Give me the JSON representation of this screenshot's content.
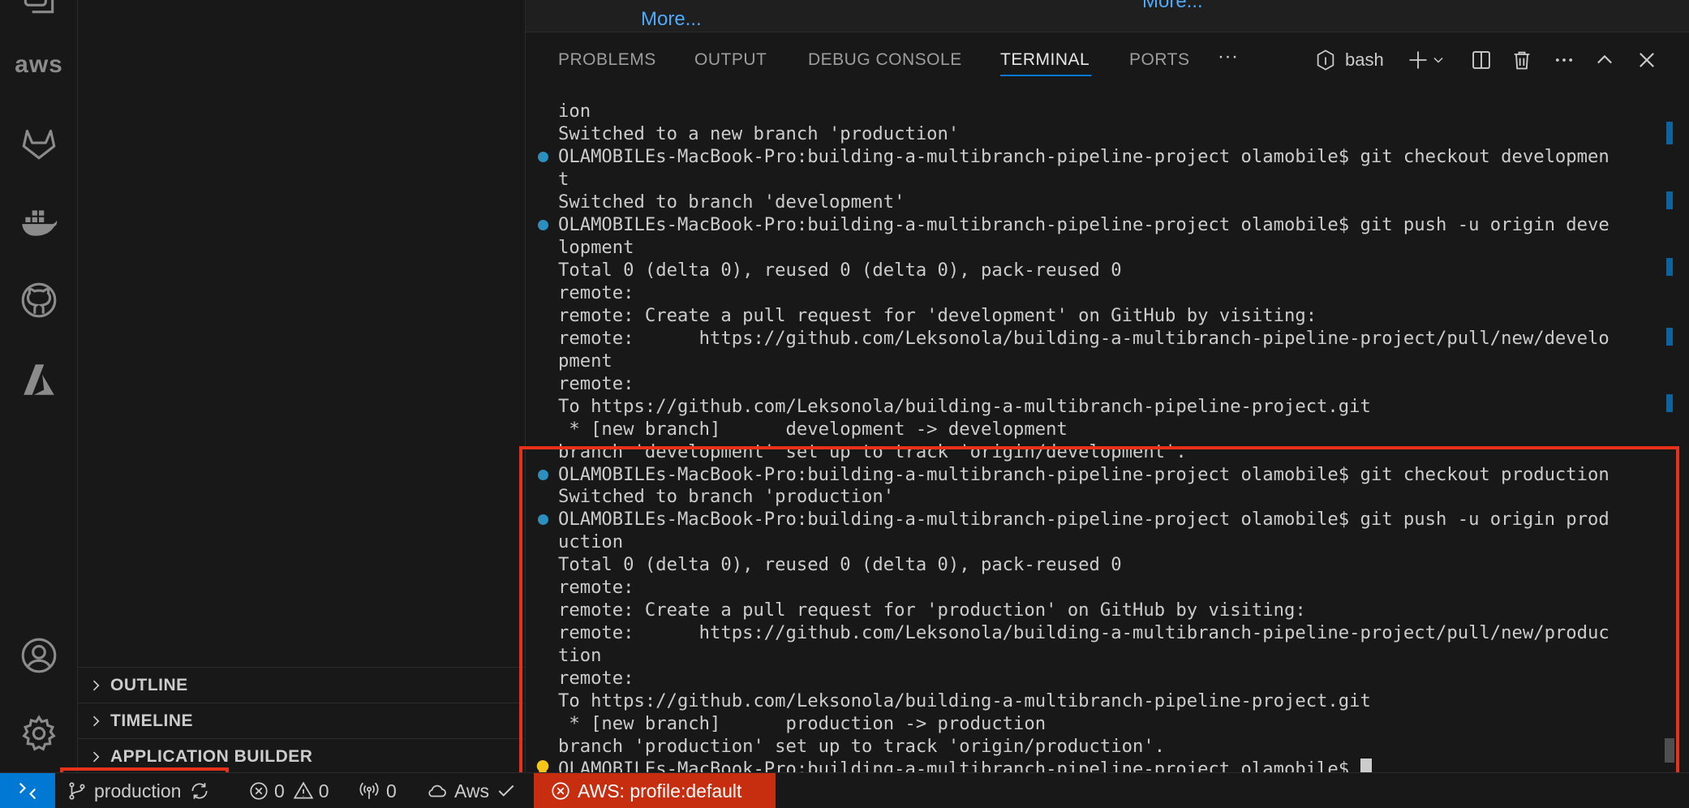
{
  "activity_bar": {
    "icons": [
      "accounts-icon",
      "aws-icon",
      "gitlab-icon",
      "docker-icon",
      "github-icon",
      "azure-icon",
      "account-icon",
      "settings-icon"
    ],
    "aws_text": "aws"
  },
  "side_bar": {
    "sections": [
      {
        "label": "OUTLINE"
      },
      {
        "label": "TIMELINE"
      },
      {
        "label": "APPLICATION BUILDER"
      }
    ]
  },
  "editor": {
    "more_link_1": "More...",
    "more_link_2": "More..."
  },
  "panel": {
    "tabs": [
      {
        "label": "PROBLEMS"
      },
      {
        "label": "OUTPUT"
      },
      {
        "label": "DEBUG CONSOLE"
      },
      {
        "label": "TERMINAL",
        "active": true
      },
      {
        "label": "PORTS"
      }
    ],
    "overflow": "···",
    "terminal_profile": "bash",
    "actions": [
      "new-terminal-icon",
      "split-terminal-icon",
      "kill-terminal-icon",
      "more-actions-icon",
      "maximize-panel-icon",
      "close-panel-icon"
    ]
  },
  "terminal": {
    "lines": [
      {
        "text": "ion",
        "marker": ""
      },
      {
        "text": "Switched to a new branch 'production'",
        "marker": ""
      },
      {
        "text": "OLAMOBILEs-MacBook-Pro:building-a-multibranch-pipeline-project olamobile$ git checkout developmen",
        "marker": "dot"
      },
      {
        "text": "t",
        "marker": ""
      },
      {
        "text": "Switched to branch 'development'",
        "marker": ""
      },
      {
        "text": "OLAMOBILEs-MacBook-Pro:building-a-multibranch-pipeline-project olamobile$ git push -u origin deve",
        "marker": "dot"
      },
      {
        "text": "lopment",
        "marker": ""
      },
      {
        "text": "Total 0 (delta 0), reused 0 (delta 0), pack-reused 0",
        "marker": ""
      },
      {
        "text": "remote:",
        "marker": ""
      },
      {
        "text": "remote: Create a pull request for 'development' on GitHub by visiting:",
        "marker": ""
      },
      {
        "text": "remote:      https://github.com/Leksonola/building-a-multibranch-pipeline-project/pull/new/develo",
        "marker": ""
      },
      {
        "text": "pment",
        "marker": ""
      },
      {
        "text": "remote:",
        "marker": ""
      },
      {
        "text": "To https://github.com/Leksonola/building-a-multibranch-pipeline-project.git",
        "marker": ""
      },
      {
        "text": " * [new branch]      development -> development",
        "marker": ""
      },
      {
        "text": "branch 'development' set up to track 'origin/development'.",
        "marker": ""
      },
      {
        "text": "OLAMOBILEs-MacBook-Pro:building-a-multibranch-pipeline-project olamobile$ git checkout production",
        "marker": "dot"
      },
      {
        "text": "Switched to branch 'production'",
        "marker": ""
      },
      {
        "text": "OLAMOBILEs-MacBook-Pro:building-a-multibranch-pipeline-project olamobile$ git push -u origin prod",
        "marker": "dot"
      },
      {
        "text": "uction",
        "marker": ""
      },
      {
        "text": "Total 0 (delta 0), reused 0 (delta 0), pack-reused 0",
        "marker": ""
      },
      {
        "text": "remote:",
        "marker": ""
      },
      {
        "text": "remote: Create a pull request for 'production' on GitHub by visiting:",
        "marker": ""
      },
      {
        "text": "remote:      https://github.com/Leksonola/building-a-multibranch-pipeline-project/pull/new/produc",
        "marker": ""
      },
      {
        "text": "tion",
        "marker": ""
      },
      {
        "text": "remote:",
        "marker": ""
      },
      {
        "text": "To https://github.com/Leksonola/building-a-multibranch-pipeline-project.git",
        "marker": ""
      },
      {
        "text": " * [new branch]      production -> production",
        "marker": ""
      },
      {
        "text": "branch 'production' set up to track 'origin/production'.",
        "marker": ""
      },
      {
        "text": "OLAMOBILEs-MacBook-Pro:building-a-multibranch-pipeline-project olamobile$ ",
        "marker": "bulb"
      }
    ]
  },
  "status_bar": {
    "branch": "production",
    "errors": "0",
    "warnings": "0",
    "ports": "0",
    "aws_connection": "Aws",
    "aws_profile": "AWS: profile:default"
  },
  "colors": {
    "accent": "#0078d4",
    "highlight_box": "#e8311a",
    "aws_profile_bg": "#c72e0f",
    "decoration_dot": "#2b8fbf"
  }
}
